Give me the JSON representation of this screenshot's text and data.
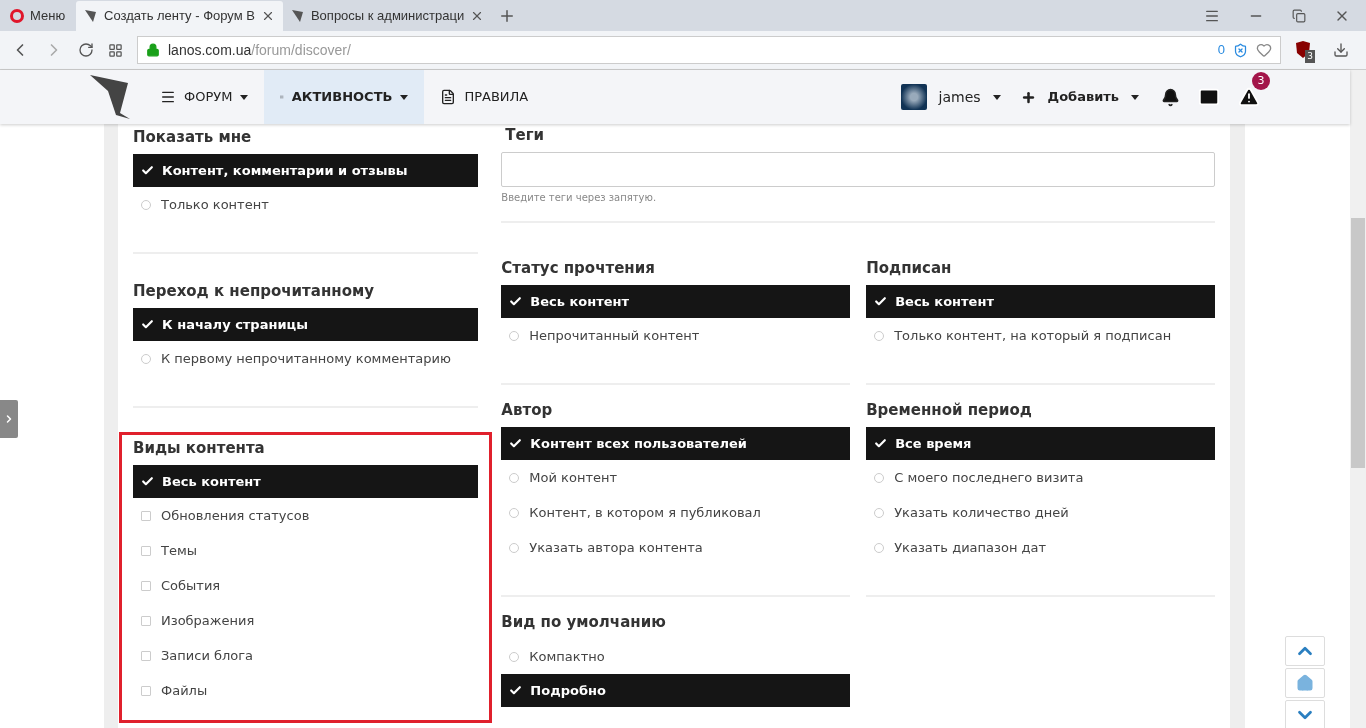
{
  "browser": {
    "menu": "Меню",
    "tabs": [
      {
        "title": "Создать ленту - Форум В",
        "selected": true
      },
      {
        "title": "Вопросы к администраци",
        "selected": false
      }
    ],
    "url_host": "lanos.com.ua",
    "url_path": "/forum/discover/",
    "tracker_count": "0",
    "extension_badge": "3"
  },
  "site_nav": {
    "items": [
      {
        "label": "ФОРУМ",
        "selected": false
      },
      {
        "label": "АКТИВНОСТЬ",
        "selected": true
      },
      {
        "label": "ПРАВИЛА",
        "selected": false
      }
    ],
    "user": "james",
    "add": "Добавить",
    "alerts_badge": "3"
  },
  "left_sections": [
    {
      "title": "Показать мне",
      "kind": "radio",
      "highlighted": false,
      "options": [
        {
          "label": "Контент, комментарии и отзывы",
          "selected": true
        },
        {
          "label": "Только контент",
          "selected": false
        }
      ]
    },
    {
      "title": "Переход к непрочитанному",
      "kind": "radio",
      "highlighted": false,
      "options": [
        {
          "label": "К началу страницы",
          "selected": true
        },
        {
          "label": "К первому непрочитанному комментарию",
          "selected": false
        }
      ]
    },
    {
      "title": "Виды контента",
      "kind": "checkbox",
      "highlighted": true,
      "options": [
        {
          "label": "Весь контент",
          "selected": true
        },
        {
          "label": "Обновления статусов",
          "selected": false
        },
        {
          "label": "Темы",
          "selected": false
        },
        {
          "label": "События",
          "selected": false
        },
        {
          "label": "Изображения",
          "selected": false
        },
        {
          "label": "Записи блога",
          "selected": false
        },
        {
          "label": "Файлы",
          "selected": false
        }
      ]
    }
  ],
  "tags": {
    "title": "Теги",
    "hint": "Введите теги через запятую."
  },
  "right_sections": [
    {
      "title": "Статус прочтения",
      "kind": "radio",
      "options": [
        {
          "label": "Весь контент",
          "selected": true
        },
        {
          "label": "Непрочитанный контент",
          "selected": false
        }
      ]
    },
    {
      "title": "Подписан",
      "kind": "radio",
      "options": [
        {
          "label": "Весь контент",
          "selected": true
        },
        {
          "label": "Только контент, на который я подписан",
          "selected": false
        }
      ]
    },
    {
      "title": "Автор",
      "kind": "radio",
      "options": [
        {
          "label": "Контент всех пользователей",
          "selected": true
        },
        {
          "label": "Мой контент",
          "selected": false
        },
        {
          "label": "Контент, в котором я публиковал",
          "selected": false
        },
        {
          "label": "Указать автора контента",
          "selected": false
        }
      ]
    },
    {
      "title": "Временной период",
      "kind": "radio",
      "options": [
        {
          "label": "Все время",
          "selected": true
        },
        {
          "label": "С моего последнего визита",
          "selected": false
        },
        {
          "label": "Указать количество дней",
          "selected": false
        },
        {
          "label": "Указать диапазон дат",
          "selected": false
        }
      ]
    },
    {
      "title": "Вид по умолчанию",
      "kind": "radio",
      "options": [
        {
          "label": "Компактно",
          "selected": false
        },
        {
          "label": "Подробно",
          "selected": true
        }
      ]
    }
  ]
}
